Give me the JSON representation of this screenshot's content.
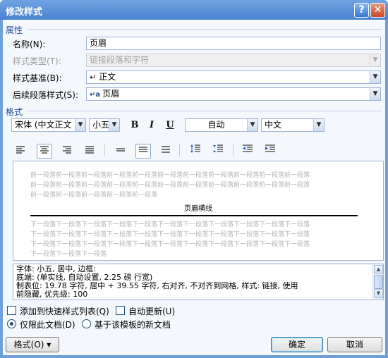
{
  "window": {
    "title": "修改样式",
    "help_label": "?",
    "close_label": "✕"
  },
  "properties": {
    "section_label": "属性",
    "name_label": "名称(N):",
    "name_value": "页眉",
    "type_label": "样式类型(T):",
    "type_value": "链接段落和字符",
    "based_on_label": "样式基准(B):",
    "based_on_value": "正文",
    "based_on_icon": "paragraph-mark-icon",
    "following_label": "后续段落样式(S):",
    "following_value": "页眉",
    "following_icon": "linked-style-icon"
  },
  "format": {
    "section_label": "格式",
    "font_value": "宋体 (中文正文",
    "size_value": "小五",
    "bold_label": "B",
    "italic_label": "I",
    "underline_label": "U",
    "color_value": "自动",
    "language_value": "中文"
  },
  "preview": {
    "prev_lines": [
      "前一段落前一段落前一段落前一段落前一段落前一段落前一段落前一段落前一段落前一段落前一段落",
      "前一段落前一段落前一段落前一段落前一段落前一段落前一段落前一段落前一段落前一段落前一段落",
      "前一段落前一段落前一段落前一段落前一段落"
    ],
    "sample_text": "页眉横线",
    "next_lines": [
      "下一段落下一段落下一段落下一段落下一段落下一段落下一段落下一段落下一段落下一段落下一段落",
      "下一段落下一段落下一段落下一段落下一段落下一段落下一段落下一段落下一段落下一段落下一段落",
      "下一段落下一段落下一段落下一段落下一段落下一段落下一段落下一段落下一段落下一段落下一段落",
      "下一段落下一段落下一段落"
    ]
  },
  "description": {
    "lines": [
      "字体: 小五, 居中, 边框:",
      "    底端: (单实线, 自动设置,  2.25 磅 行宽)",
      "    制表位: 19.78 字符, 居中 +  39.55 字符, 右对齐, 不对齐到网格, 样式: 链接, 使用",
      "前隐藏, 优先级: 100"
    ]
  },
  "options": {
    "add_to_quick_styles": "添加到快速样式列表(Q)",
    "auto_update": "自动更新(U)",
    "only_this_document": "仅限此文档(D)",
    "new_docs_template": "基于该模板的新文档"
  },
  "buttons": {
    "format_label": "格式(O) ▾",
    "ok_label": "确定",
    "cancel_label": "取消"
  },
  "colors": {
    "titlebar": "#4a82cf",
    "section_label": "#1f4e9c",
    "client_bg": "#f4f7fc"
  }
}
